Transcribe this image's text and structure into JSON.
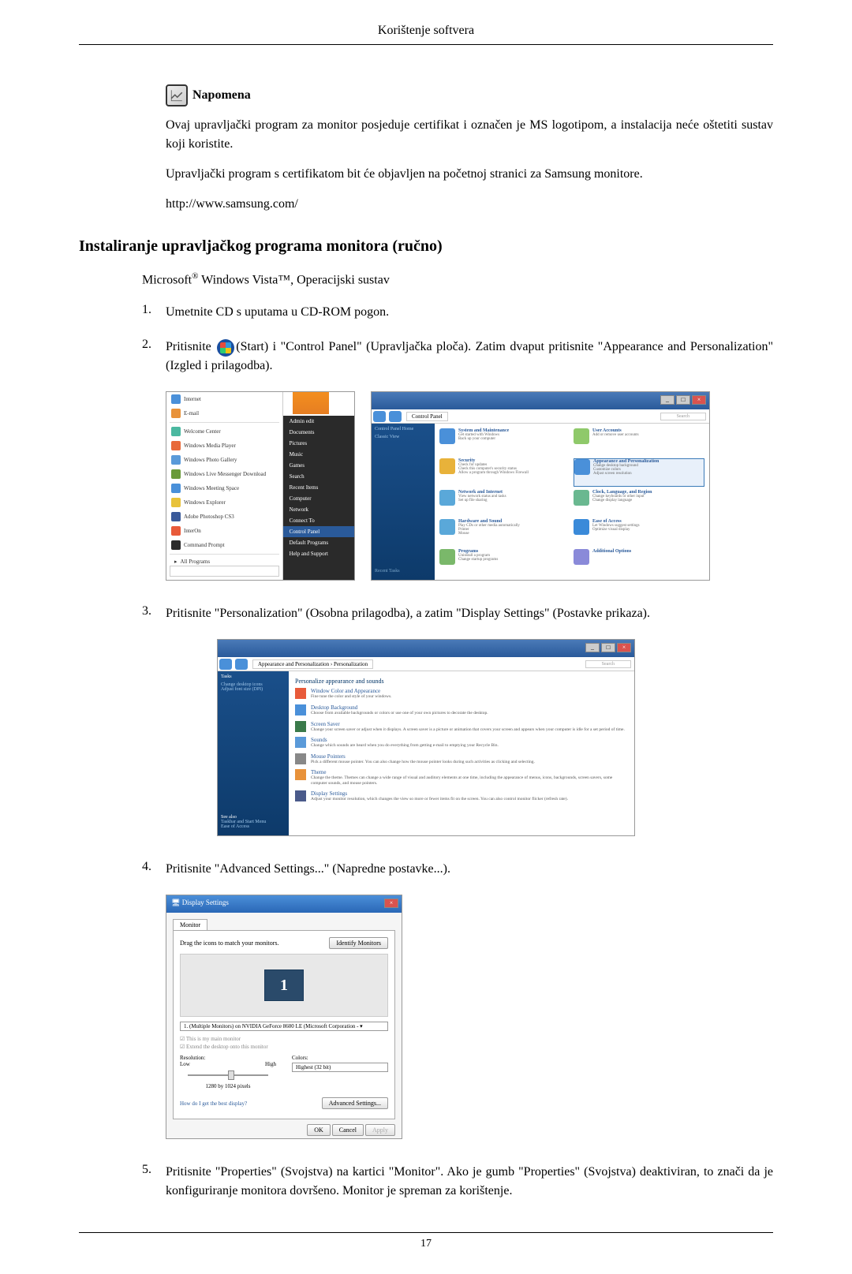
{
  "header": "Korištenje softvera",
  "note": {
    "label": "Napomena",
    "paragraphs": [
      "Ovaj upravljački program za monitor posjeduje certifikat i označen je MS logotipom, a instalacija neće oštetiti sustav koji koristite.",
      "Upravljački program s certifikatom bit će objavljen na početnoj stranici za Samsung monitore.",
      "http://www.samsung.com/"
    ]
  },
  "section_heading": "Instaliranje upravljačkog programa monitora (ručno)",
  "os_line_prefix": "Microsoft",
  "os_line_mid": " Windows Vista™, Operacijski sustav",
  "steps": {
    "1": "Umetnite CD s uputama u CD-ROM pogon.",
    "2_before": "Pritisnite ",
    "2_after": "(Start) i \"Control Panel\" (Upravljačka ploča). Zatim dvaput pritisnite \"Appearance and Personalization\" (Izgled i prilagodba).",
    "3": "Pritisnite \"Personalization\" (Osobna prilagodba), a zatim \"Display Settings\" (Postavke prikaza).",
    "4": "Pritisnite \"Advanced Settings...\" (Napredne postavke...).",
    "5": "Pritisnite \"Properties\" (Svojstva) na kartici \"Monitor\". Ako je gumb \"Properties\" (Svojstva) deaktiviran, to znači da je konfiguriranje monitora dovršeno. Monitor je spreman za korištenje."
  },
  "start_menu": {
    "items": [
      "Internet",
      "E-mail",
      "Welcome Center",
      "Windows Media Player",
      "Windows Photo Gallery",
      "Windows Live Messenger Download",
      "Windows Meeting Space",
      "Windows Explorer",
      "Adobe Photoshop CS3",
      "InterOn",
      "Command Prompt"
    ],
    "right_items": [
      "Admin edit",
      "Documents",
      "Pictures",
      "Music",
      "Games",
      "Search",
      "Recent Items",
      "Computer",
      "Network",
      "Connect To",
      "Control Panel",
      "Default Programs",
      "Help and Support"
    ],
    "all_programs": "All Programs"
  },
  "control_panel": {
    "breadcrumb": "Control Panel",
    "sidebar": [
      "Control Panel Home",
      "Classic View"
    ],
    "sidebar_bottom": "Recent Tasks",
    "categories": [
      {
        "main": "System and Maintenance",
        "sub": "Get started with Windows\nBack up your computer",
        "color": "#4a90d9"
      },
      {
        "main": "User Accounts",
        "sub": "Add or remove user accounts",
        "color": "#8fc96a"
      },
      {
        "main": "Security",
        "sub": "Check for updates\nCheck this computer's security status\nAllow a program through Windows Firewall",
        "color": "#e8b23a"
      },
      {
        "main": "Appearance and Personalization",
        "sub": "Change desktop background\nCustomize colors\nAdjust screen resolution",
        "color": "#4a90d9",
        "highlighted": true
      },
      {
        "main": "Network and Internet",
        "sub": "View network status and tasks\nSet up file sharing",
        "color": "#5aa8d9"
      },
      {
        "main": "Clock, Language, and Region",
        "sub": "Change keyboards or other input\nChange display language",
        "color": "#6ab890"
      },
      {
        "main": "Hardware and Sound",
        "sub": "Play CDs or other media automatically\nPrinter\nMouse",
        "color": "#5aa8d9"
      },
      {
        "main": "Ease of Access",
        "sub": "Let Windows suggest settings\nOptimize visual display",
        "color": "#3a8ad9"
      },
      {
        "main": "Programs",
        "sub": "Uninstall a program\nChange startup programs",
        "color": "#7ab86a"
      },
      {
        "main": "Additional Options",
        "sub": "",
        "color": "#8a8ad9"
      }
    ]
  },
  "personalization": {
    "breadcrumb": "Appearance and Personalization › Personalization",
    "heading": "Personalize appearance and sounds",
    "sidebar": [
      "Tasks",
      "Change desktop icons",
      "Adjust font size (DPI)"
    ],
    "sidebar_bottom": [
      "See also",
      "Taskbar and Start Menu",
      "Ease of Access"
    ],
    "items": [
      {
        "link": "Window Color and Appearance",
        "desc": "Fine tune the color and style of your windows."
      },
      {
        "link": "Desktop Background",
        "desc": "Choose from available backgrounds or colors or use one of your own pictures to decorate the desktop."
      },
      {
        "link": "Screen Saver",
        "desc": "Change your screen saver or adjust when it displays. A screen saver is a picture or animation that covers your screen and appears when your computer is idle for a set period of time."
      },
      {
        "link": "Sounds",
        "desc": "Change which sounds are heard when you do everything from getting e-mail to emptying your Recycle Bin."
      },
      {
        "link": "Mouse Pointers",
        "desc": "Pick a different mouse pointer. You can also change how the mouse pointer looks during such activities as clicking and selecting."
      },
      {
        "link": "Theme",
        "desc": "Change the theme. Themes can change a wide range of visual and auditory elements at one time, including the appearance of menus, icons, backgrounds, screen savers, some computer sounds, and mouse pointers."
      },
      {
        "link": "Display Settings",
        "desc": "Adjust your monitor resolution, which changes the view so more or fewer items fit on the screen. You can also control monitor flicker (refresh rate)."
      }
    ]
  },
  "display_settings": {
    "title": "Display Settings",
    "tab": "Monitor",
    "drag_text": "Drag the icons to match your monitors.",
    "identify_btn": "Identify Monitors",
    "monitor_num": "1",
    "dropdown": "1. (Multiple Monitors) on NVIDIA GeForce 8600 LE (Microsoft Corporation - ▾",
    "cb1": "This is my main monitor",
    "cb2": "Extend the desktop onto this monitor",
    "resolution_label": "Resolution:",
    "res_low": "Low",
    "res_high": "High",
    "res_value": "1280 by 1024 pixels",
    "colors_label": "Colors:",
    "colors_value": "Highest (32 bit)",
    "link": "How do I get the best display?",
    "adv_btn": "Advanced Settings...",
    "ok": "OK",
    "cancel": "Cancel",
    "apply": "Apply"
  },
  "page_number": "17"
}
